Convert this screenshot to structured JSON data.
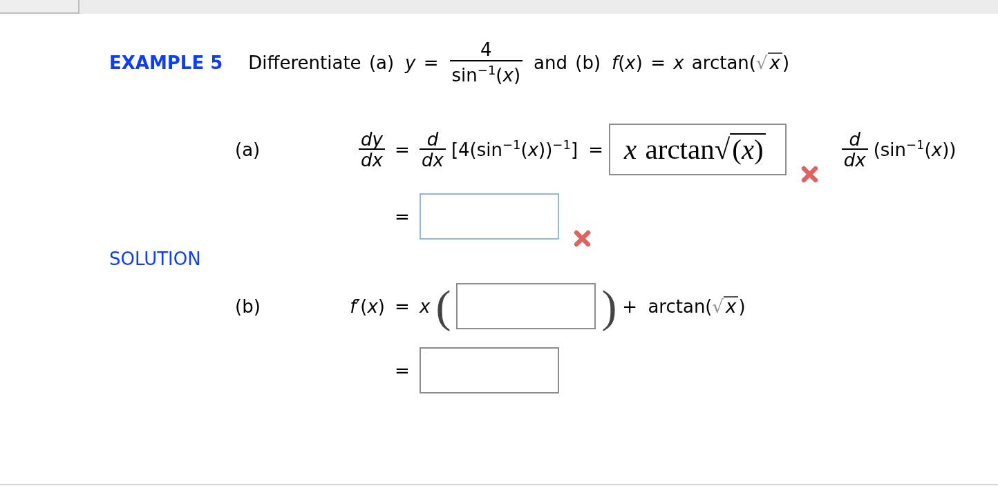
{
  "example": {
    "label": "EXAMPLE 5",
    "segments": [
      {
        "kind": "text",
        "text": "Differentiate (a)"
      },
      {
        "kind": "text",
        "text": "*y* ="
      },
      {
        "kind": "fraction",
        "numerator": "4",
        "denominator": "sin$^{−1}$(*x*)"
      },
      {
        "kind": "text",
        "text": "and (b)"
      },
      {
        "kind": "radical_text",
        "before": "*f*(*x*) = *x* arctan(",
        "radical": "√",
        "radicand": "*x*",
        "after": ")"
      }
    ]
  },
  "solution": {
    "label": "SOLUTION",
    "parts": [
      {
        "label": "(a)",
        "steps": [
          {
            "lhs": {
              "kind": "fraction",
              "numerator": "*dy*",
              "denominator": "*dx*"
            },
            "equals": "=",
            "rhs": [
              {
                "kind": "fraction",
                "numerator": "*d*",
                "denominator": "*dx*"
              },
              {
                "kind": "text",
                "text": "[4(sin$^{−1}$(*x*))$^{−1}$] ="
              },
              {
                "kind": "answer",
                "value": {
                  "before": "*x* arctan",
                  "radical": "√",
                  "radicand": "(*x*)"
                },
                "focused": false,
                "marked_incorrect": true
              },
              {
                "kind": "fraction",
                "numerator": "*d*",
                "denominator": "*dx*"
              },
              {
                "kind": "text",
                "text": "(sin$^{−1}$(*x*))"
              }
            ]
          },
          {
            "equals": "=",
            "rhs": [
              {
                "kind": "answer",
                "focused": true,
                "marked_incorrect": true
              }
            ]
          }
        ]
      },
      {
        "label": "(b)",
        "steps": [
          {
            "lhs": {
              "kind": "text",
              "text": "*f*′(*x*)"
            },
            "equals": "=",
            "rhs": [
              {
                "kind": "text",
                "text": "*x*"
              },
              {
                "kind": "paren",
                "text": "("
              },
              {
                "kind": "answer",
                "focused": false,
                "marked_incorrect": false
              },
              {
                "kind": "paren",
                "text": ")"
              },
              {
                "kind": "radical_text",
                "before": "+ arctan(",
                "radical": "√",
                "radicand": "*x*",
                "after": ")"
              }
            ]
          },
          {
            "equals": "=",
            "rhs": [
              {
                "kind": "answer",
                "focused": false,
                "marked_incorrect": false
              }
            ]
          }
        ]
      }
    ]
  }
}
